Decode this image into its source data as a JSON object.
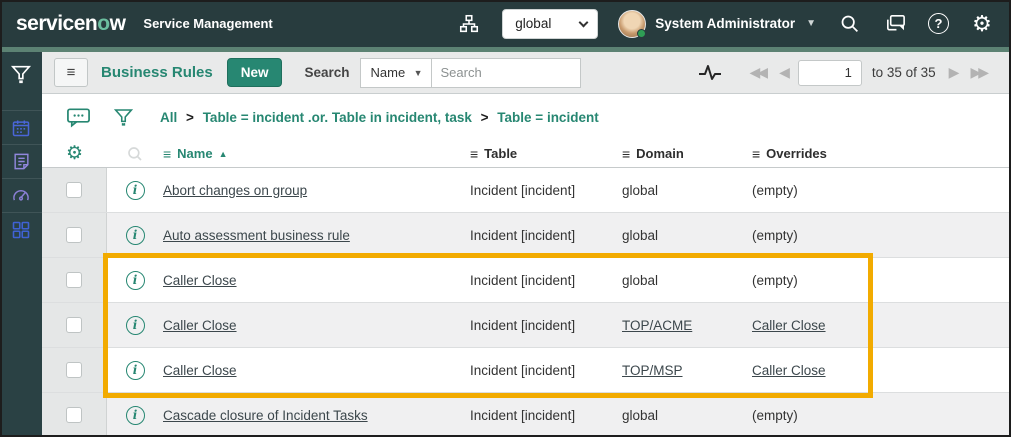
{
  "colors": {
    "header_bg": "#283c3e",
    "green_strip": "#5c8273",
    "accent_teal": "#278772",
    "highlight_gold": "#f2ab00",
    "alt_row_bg": "#f0f0f1"
  },
  "banner": {
    "logo_prefix": "servicen",
    "logo_o": "o",
    "logo_suffix": "w",
    "app_title": "Service Management",
    "scope_select_value": "global",
    "user_name": "System Administrator",
    "help_glyph": "?",
    "gear_glyph": "⚙"
  },
  "toolbar": {
    "hamburger_glyph": "≡",
    "list_title": "Business Rules",
    "new_button_label": "New",
    "search_label": "Search",
    "search_column_value": "Name",
    "search_column_arrow": "▼",
    "search_placeholder": "Search",
    "pagination": {
      "first_glyph": "◀◀",
      "prev_glyph": "◀",
      "page_value": "1",
      "range_label": "to 35 of 35",
      "next_glyph": "▶",
      "last_glyph": "▶▶"
    }
  },
  "breadcrumb": {
    "separator": ">",
    "items": [
      "All",
      "Table = incident .or. Table in incident, task",
      "Table = incident"
    ]
  },
  "list": {
    "gear_glyph": "⚙",
    "column_menu_glyph": "≡",
    "sort_asc_glyph": "▲",
    "info_glyph": "i",
    "columns": [
      {
        "label": "Name"
      },
      {
        "label": "Table"
      },
      {
        "label": "Domain"
      },
      {
        "label": "Overrides"
      }
    ],
    "rows": [
      {
        "name": "Abort changes on group",
        "table": "Incident [incident]",
        "domain": "global",
        "overrides": "(empty)"
      },
      {
        "name": "Auto assessment business rule",
        "table": "Incident [incident]",
        "domain": "global",
        "overrides": "(empty)"
      },
      {
        "name": "Caller Close",
        "table": "Incident [incident]",
        "domain": "global",
        "overrides": "(empty)"
      },
      {
        "name": "Caller Close",
        "table": "Incident [incident]",
        "domain": "TOP/ACME",
        "overrides": "Caller Close"
      },
      {
        "name": "Caller Close",
        "table": "Incident [incident]",
        "domain": "TOP/MSP",
        "overrides": "Caller Close"
      },
      {
        "name": "Cascade closure of Incident Tasks",
        "table": "Incident [incident]",
        "domain": "global",
        "overrides": "(empty)"
      }
    ]
  }
}
